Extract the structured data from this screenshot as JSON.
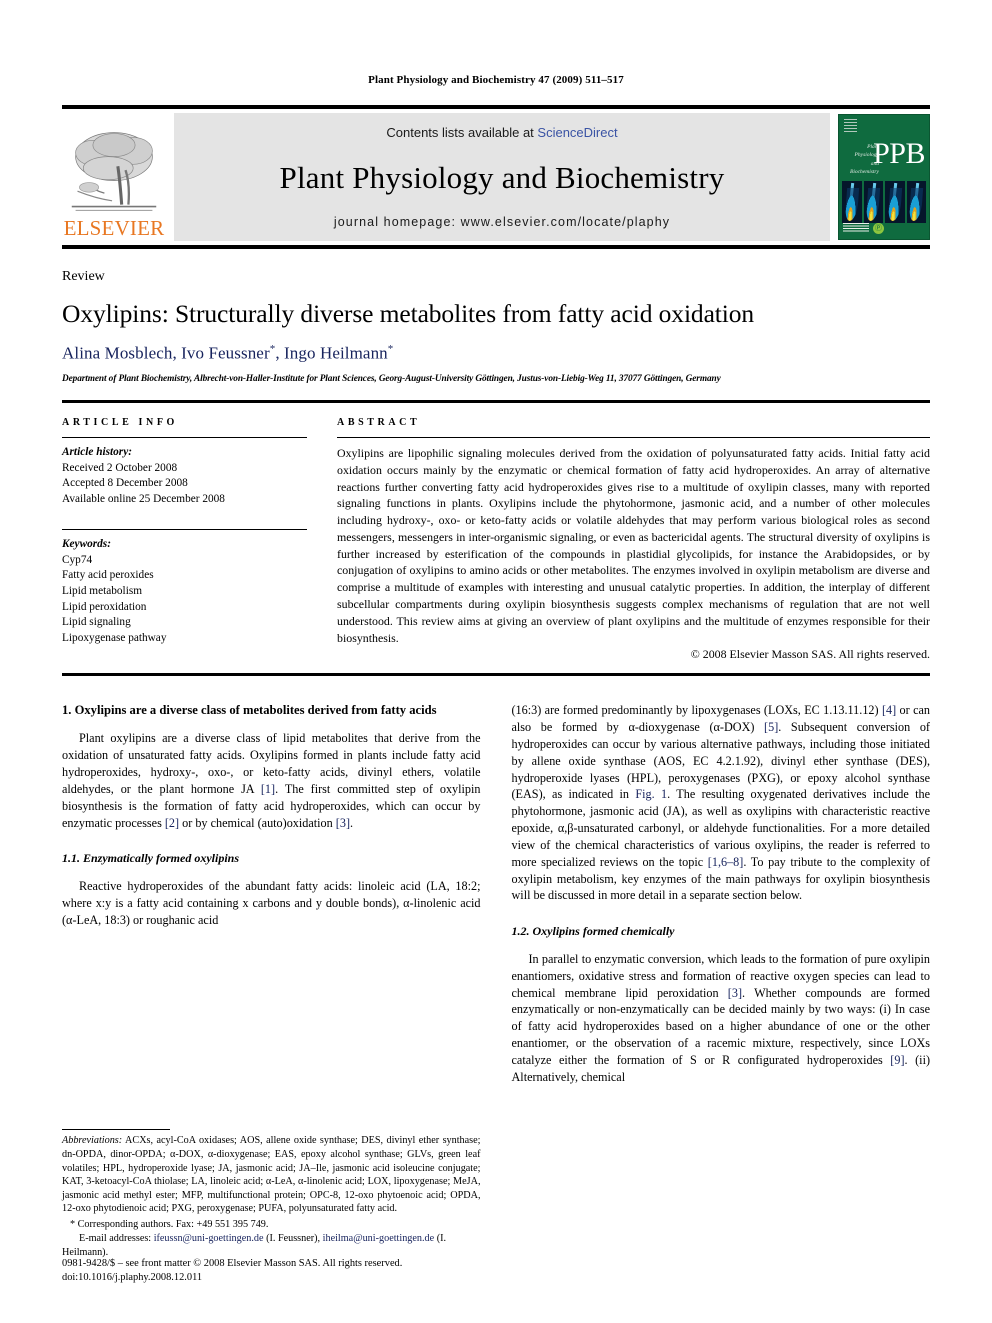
{
  "running_head": "Plant Physiology and Biochemistry 47 (2009) 511–517",
  "masthead": {
    "contents_prefix": "Contents lists available at ",
    "sciencedirect": "ScienceDirect",
    "journal_title": "Plant Physiology and Biochemistry",
    "homepage": "journal homepage: www.elsevier.com/locate/plaphy",
    "elsevier_word": "ELSEVIER",
    "cover": {
      "letters": "PPB",
      "line1": "Plant",
      "line2": "Physiology",
      "line3": "and",
      "line4": "Biochemistry",
      "mark": "Ⓟ"
    },
    "colors": {
      "link": "#3a53a4",
      "elsevier_orange": "#E87722",
      "cover_green": "#0f6b3f",
      "band_grey": "#e4e4e4"
    }
  },
  "article": {
    "doc_type": "Review",
    "title": "Oxylipins: Structurally diverse metabolites from fatty acid oxidation",
    "authors_plain": "Alina Mosblech, Ivo Feussner",
    "authors_part2": ", Ingo Heilmann",
    "author_marker": "*",
    "affiliation": "Department of Plant Biochemistry, Albrecht-von-Haller-Institute for Plant Sciences, Georg-August-University Göttingen, Justus-von-Liebig-Weg 11, 37077 Göttingen, Germany"
  },
  "article_info": {
    "heading": "ARTICLE INFO",
    "history_label": "Article history:",
    "history": [
      "Received 2 October 2008",
      "Accepted 8 December 2008",
      "Available online 25 December 2008"
    ],
    "keywords_label": "Keywords:",
    "keywords": [
      "Cyp74",
      "Fatty acid peroxides",
      "Lipid metabolism",
      "Lipid peroxidation",
      "Lipid signaling",
      "Lipoxygenase pathway"
    ]
  },
  "abstract": {
    "heading": "ABSTRACT",
    "text": "Oxylipins are lipophilic signaling molecules derived from the oxidation of polyunsaturated fatty acids. Initial fatty acid oxidation occurs mainly by the enzymatic or chemical formation of fatty acid hydroperoxides. An array of alternative reactions further converting fatty acid hydroperoxides gives rise to a multitude of oxylipin classes, many with reported signaling functions in plants. Oxylipins include the phytohormone, jasmonic acid, and a number of other molecules including hydroxy-, oxo- or keto-fatty acids or volatile aldehydes that may perform various biological roles as second messengers, messengers in inter-organismic signaling, or even as bactericidal agents. The structural diversity of oxylipins is further increased by esterification of the compounds in plastidial glycolipids, for instance the Arabidopsides, or by conjugation of oxylipins to amino acids or other metabolites. The enzymes involved in oxylipin metabolism are diverse and comprise a multitude of examples with interesting and unusual catalytic properties. In addition, the interplay of different subcellular compartments during oxylipin biosynthesis suggests complex mechanisms of regulation that are not well understood. This review aims at giving an overview of plant oxylipins and the multitude of enzymes responsible for their biosynthesis.",
    "copyright": "© 2008 Elsevier Masson SAS. All rights reserved."
  },
  "body": {
    "left": {
      "section1_heading": "1. Oxylipins are a diverse class of metabolites derived from fatty acids",
      "para1_a": "Plant oxylipins are a diverse class of lipid metabolites that derive from the oxidation of unsaturated fatty acids. Oxylipins formed in plants include fatty acid hydroperoxides, hydroxy-, oxo-, or keto-fatty acids, divinyl ethers, volatile aldehydes, or the plant hormone JA ",
      "ref1": "[1]",
      "para1_b": ". The first committed step of oxylipin biosynthesis is the formation of fatty acid hydroperoxides, which can occur by enzymatic processes ",
      "ref2": "[2]",
      "para1_c": " or by chemical (auto)oxidation ",
      "ref3": "[3]",
      "para1_d": ".",
      "subsection11_heading": "1.1. Enzymatically formed oxylipins",
      "para2": "Reactive hydroperoxides of the abundant fatty acids: linoleic acid (LA, 18:2; where x:y is a fatty acid containing x carbons and y double bonds), α-linolenic acid (α-LeA, 18:3) or roughanic acid"
    },
    "right": {
      "para3_a": "(16:3) are formed predominantly by lipoxygenases (LOXs, EC 1.13.11.12) ",
      "ref4": "[4]",
      "para3_b": " or can also be formed by α-dioxygenase (α-DOX) ",
      "ref5": "[5]",
      "para3_c": ". Subsequent conversion of hydroperoxides can occur by various alternative pathways, including those initiated by allene oxide synthase (AOS, EC 4.2.1.92), divinyl ether synthase (DES), hydroperoxide lyases (HPL), peroxygenases (PXG), or epoxy alcohol synthase (EAS), as indicated in ",
      "figref": "Fig. 1",
      "para3_d": ". The resulting oxygenated derivatives include the phytohormone, jasmonic acid (JA), as well as oxylipins with characteristic reactive epoxide, α,β-unsaturated carbonyl, or aldehyde functionalities. For a more detailed view of the chemical characteristics of various oxylipins, the reader is referred to more specialized reviews on the topic ",
      "ref68": "[1,6–8]",
      "para3_e": ". To pay tribute to the complexity of oxylipin metabolism, key enzymes of the main pathways for oxylipin biosynthesis will be discussed in more detail in a separate section below.",
      "subsection12_heading": "1.2. Oxylipins formed chemically",
      "para4_a": "In parallel to enzymatic conversion, which leads to the formation of pure oxylipin enantiomers, oxidative stress and formation of reactive oxygen species can lead to chemical membrane lipid peroxidation ",
      "ref3b": "[3]",
      "para4_b": ". Whether compounds are formed enzymatically or non-enzymatically can be decided mainly by two ways: (i) In case of fatty acid hydroperoxides based on a higher abundance of one or the other enantiomer, or the observation of a racemic mixture, respectively, since LOXs catalyze either the formation of S or R configurated hydroperoxides ",
      "ref9": "[9]",
      "para4_c": ". (ii) Alternatively, chemical"
    }
  },
  "footnotes": {
    "abbrev_label": "Abbreviations:",
    "abbrev_text": " ACXs, acyl-CoA oxidases; AOS, allene oxide synthase; DES, divinyl ether synthase; dn-OPDA, dinor-OPDA; α-DOX, α-dioxygenase; EAS, epoxy alcohol synthase; GLVs, green leaf volatiles; HPL, hydroperoxide lyase; JA, jasmonic acid; JA–Ile, jasmonic acid isoleucine conjugate; KAT, 3-ketoacyl-CoA thiolase; LA, linoleic acid; α-LeA, α-linolenic acid; LOX, lipoxygenase; MeJA, jasmonic acid methyl ester; MFP, multifunctional protein; OPC-8, 12-oxo phytoenoic acid; OPDA, 12-oxo phytodienoic acid; PXG, peroxygenase; PUFA, polyunsaturated fatty acid.",
    "corresponding": "* Corresponding authors. Fax: +49 551 395 749.",
    "email_label": "E-mail addresses:",
    "email1": "ifeussn@uni-goettingen.de",
    "email1_who": " (I. Feussner), ",
    "email2": "iheilma@uni-goettingen.de",
    "email2_who": " (I. Heilmann)."
  },
  "page_footer": {
    "line1": "0981-9428/$ – see front matter © 2008 Elsevier Masson SAS. All rights reserved.",
    "line2": "doi:10.1016/j.plaphy.2008.12.011"
  }
}
